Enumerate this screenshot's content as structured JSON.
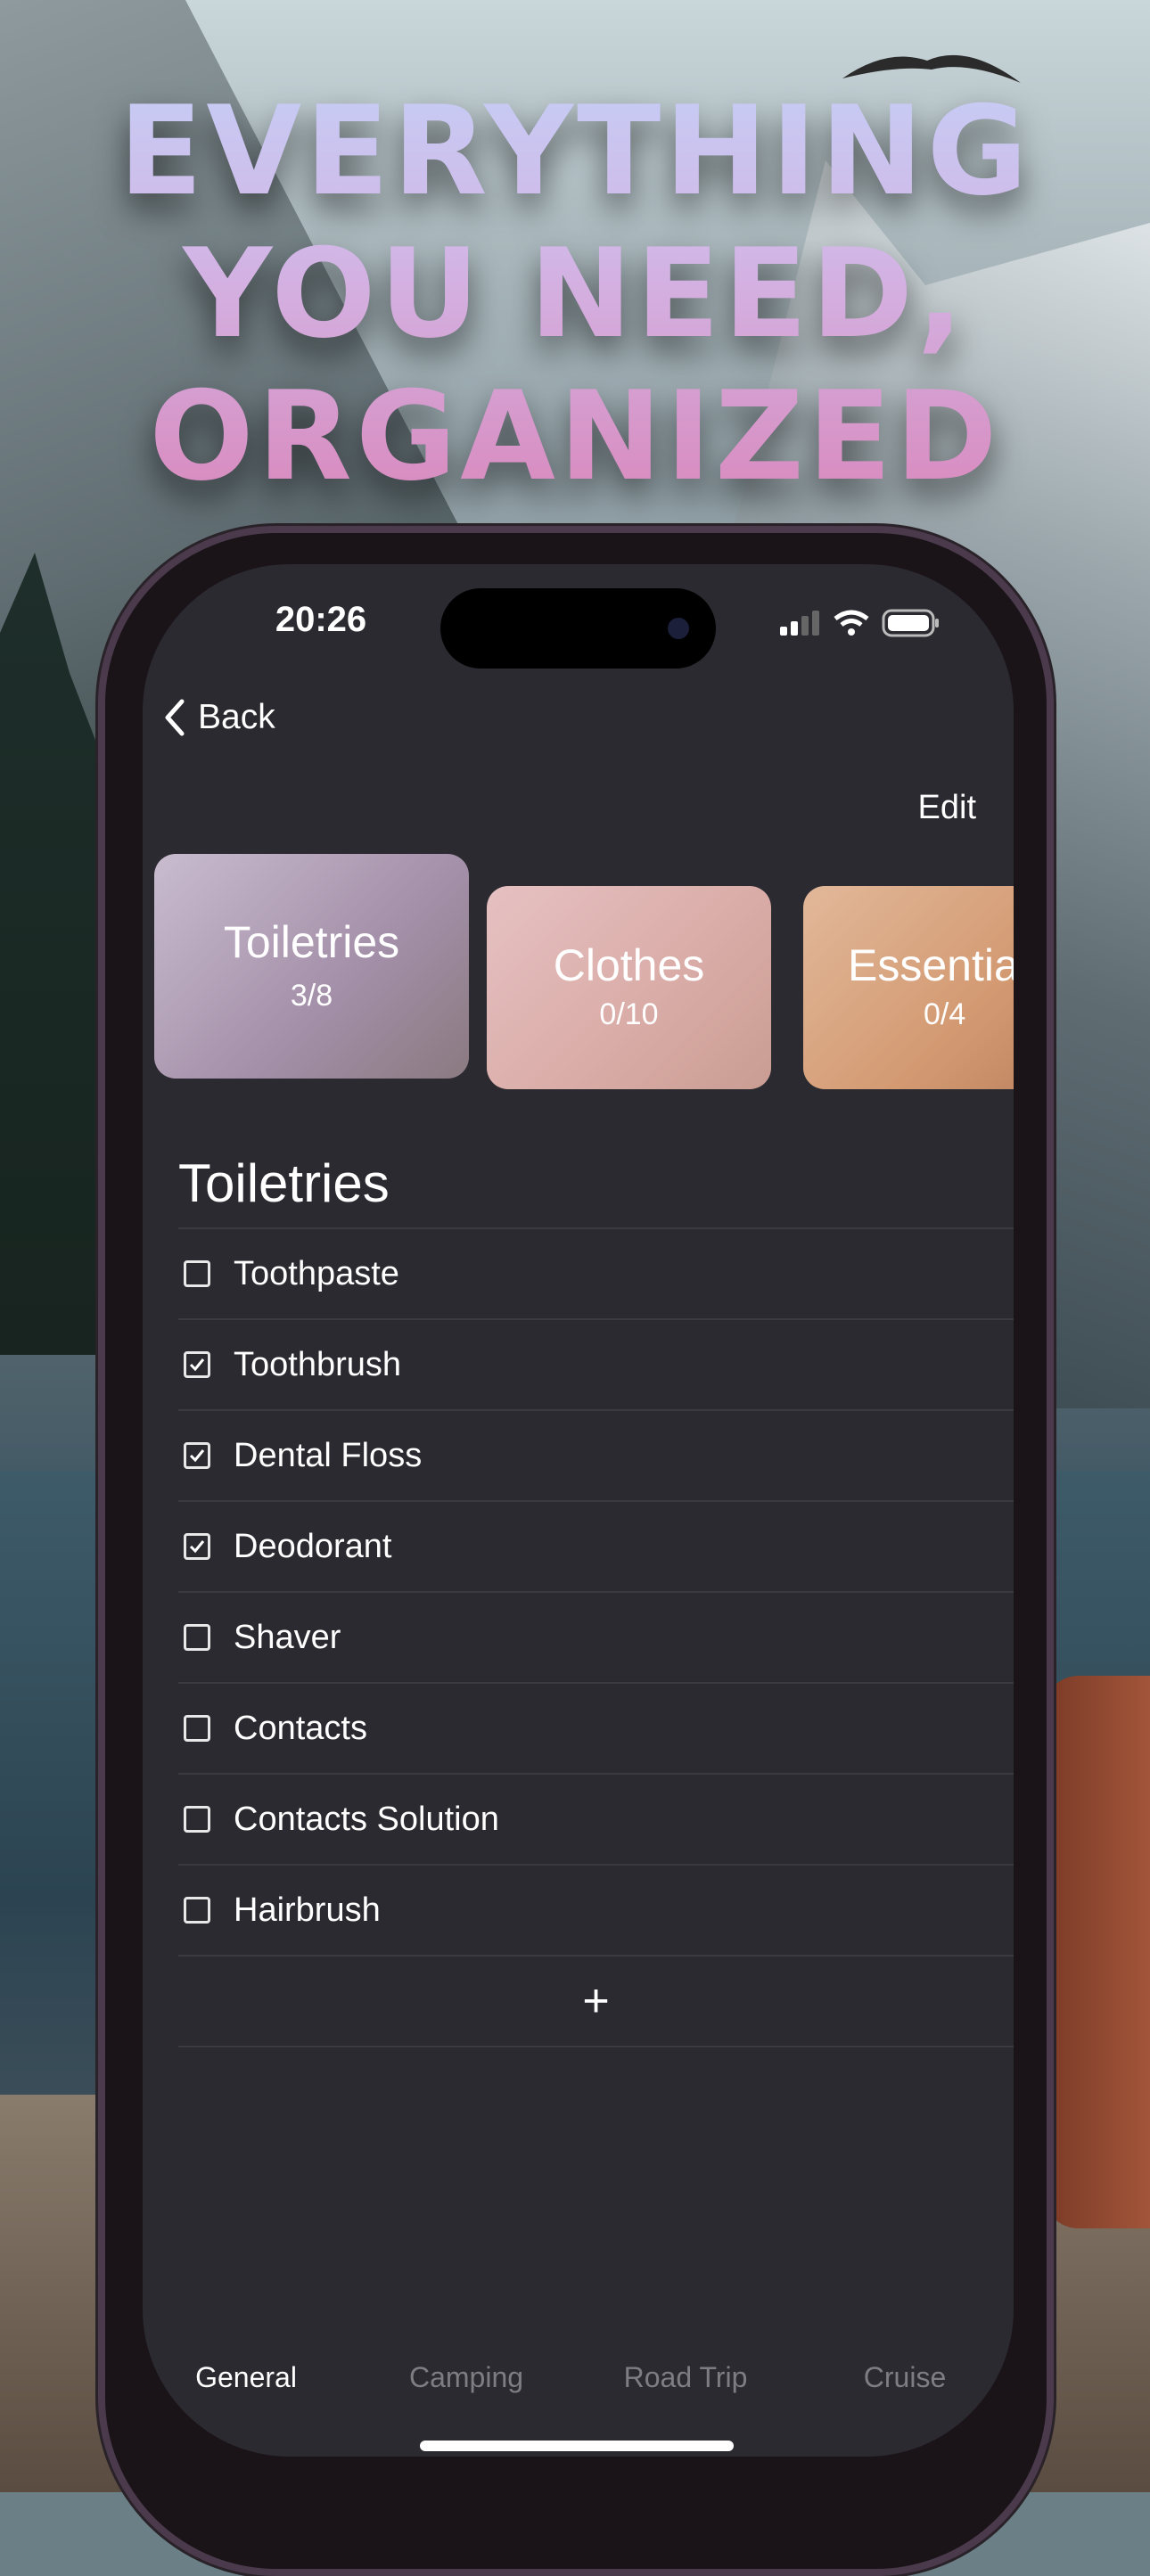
{
  "headline": [
    "EVERYTHING",
    "YOU NEED,",
    "ORGANIZED"
  ],
  "status_bar": {
    "time": "20:26",
    "icons": [
      "signal-icon",
      "wifi-icon",
      "battery-icon"
    ]
  },
  "nav": {
    "back_label": "Back",
    "edit_label": "Edit"
  },
  "categories": [
    {
      "title": "Toiletries",
      "count": "3/8",
      "selected": true,
      "color": "#b7a6c4"
    },
    {
      "title": "Clothes",
      "count": "0/10",
      "selected": false,
      "color": "#ddb2b0"
    },
    {
      "title": "Essentials",
      "count": "0/4",
      "selected": false,
      "color": "#d8a27c"
    }
  ],
  "section_title": "Toiletries",
  "items": [
    {
      "label": "Toothpaste",
      "checked": false
    },
    {
      "label": "Toothbrush",
      "checked": true
    },
    {
      "label": "Dental Floss",
      "checked": true
    },
    {
      "label": "Deodorant",
      "checked": true
    },
    {
      "label": "Shaver",
      "checked": false
    },
    {
      "label": "Contacts",
      "checked": false
    },
    {
      "label": "Contacts Solution",
      "checked": false
    },
    {
      "label": "Hairbrush",
      "checked": false
    }
  ],
  "add_label": "+",
  "tabs": [
    {
      "label": "General",
      "active": true
    },
    {
      "label": "Camping",
      "active": false
    },
    {
      "label": "Road Trip",
      "active": false
    },
    {
      "label": "Cruise",
      "active": false
    }
  ]
}
